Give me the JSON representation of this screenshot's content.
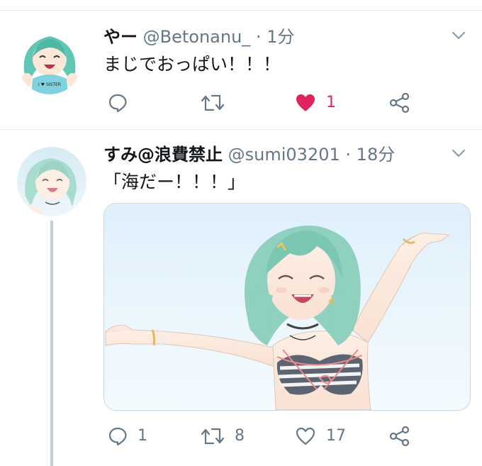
{
  "tweets": [
    {
      "name": "やー",
      "handle": "@Betonanu_",
      "separator": "·",
      "time": "1分",
      "text": "まじでおっぱい！！！",
      "avatar_shirt_text": "I ♥ SISTER",
      "actions": {
        "reply_count": "",
        "retweet_count": "",
        "like_count": "1",
        "liked": true
      }
    },
    {
      "name": "すみ@浪費禁止",
      "handle": "@sumi03201",
      "separator": "·",
      "time": "18分",
      "text": "「海だー！！！」",
      "actions": {
        "reply_count": "1",
        "retweet_count": "8",
        "like_count": "17",
        "liked": false
      }
    }
  ],
  "colors": {
    "like_active": "#e0245e",
    "icon_gray": "#657786",
    "divider": "#e6ecf0",
    "thread_line": "#c4cfd6"
  },
  "icons": [
    "reply-icon",
    "retweet-icon",
    "like-icon",
    "share-icon",
    "caret-down-icon"
  ]
}
